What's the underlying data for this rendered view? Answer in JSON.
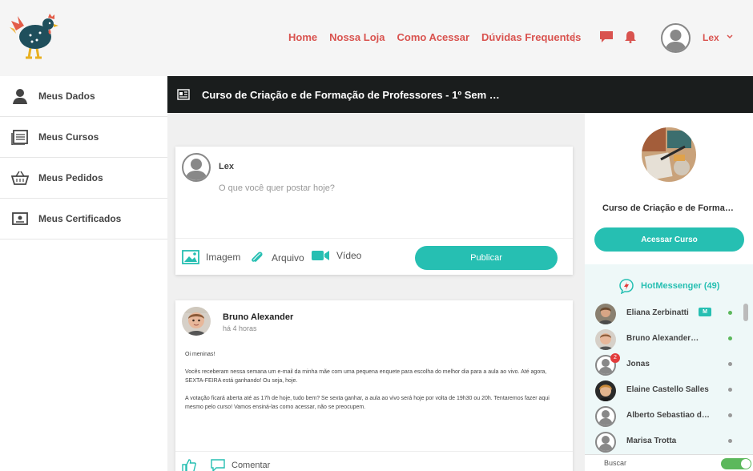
{
  "nav": {
    "items": [
      "Home",
      "Nossa Loja",
      "Como Acessar",
      "Dúvidas Frequentes"
    ],
    "separator": "|",
    "user_name": "Lex"
  },
  "sidebar": {
    "items": [
      {
        "label": "Meus Dados",
        "icon": "user-icon"
      },
      {
        "label": "Meus Cursos",
        "icon": "courses-icon"
      },
      {
        "label": "Meus Pedidos",
        "icon": "basket-icon"
      },
      {
        "label": "Meus Certificados",
        "icon": "certificate-icon"
      }
    ]
  },
  "course_bar": {
    "title": "Curso de Criação e de Formação de Professores - 1º Sem …"
  },
  "composer": {
    "user": "Lex",
    "placeholder": "O que você quer postar hoje?",
    "image_label": "Imagem",
    "file_label": "Arquivo",
    "video_label": "Vídeo",
    "publish_label": "Publicar"
  },
  "post": {
    "author": "Bruno Alexander",
    "time": "há 4 horas",
    "paragraphs": [
      "Oi meninas!",
      "Vocês receberam nessa semana um e-mail da minha mãe com uma pequena enquete para escolha do melhor dia para a aula ao vivo. Até agora, SEXTA-FEIRA está ganhando! Ou seja, hoje.",
      "A votação ficará aberta até as 17h de hoje, tudo bem? Se sexta ganhar, a aula ao vivo será hoje por volta de 19h30 ou 20h. Tentaremos fazer aqui mesmo pelo curso! Vamos ensiná-las como acessar, não se preocupem."
    ],
    "comment_label": "Comentar"
  },
  "right_panel": {
    "course_title": "Curso de Criação e de Forma…",
    "access_label": "Acessar Curso",
    "messenger_title": "HotMessenger (49)",
    "contacts": [
      {
        "name": "Eliana Zerbinatti",
        "status": "online",
        "badge": "M"
      },
      {
        "name": "Bruno Alexander…",
        "status": "online"
      },
      {
        "name": "Jonas",
        "status": "offline",
        "unread": "2"
      },
      {
        "name": "Elaine Castello Salles",
        "status": "offline"
      },
      {
        "name": "Alberto Sebastiao d…",
        "status": "offline"
      },
      {
        "name": "Marisa Trotta",
        "status": "offline"
      }
    ],
    "search_label": "Buscar"
  },
  "colors": {
    "accent": "#26bfb2",
    "nav": "#d9534f",
    "online": "#5cb85c",
    "offline": "#999999",
    "bar": "#1a1d1d"
  }
}
